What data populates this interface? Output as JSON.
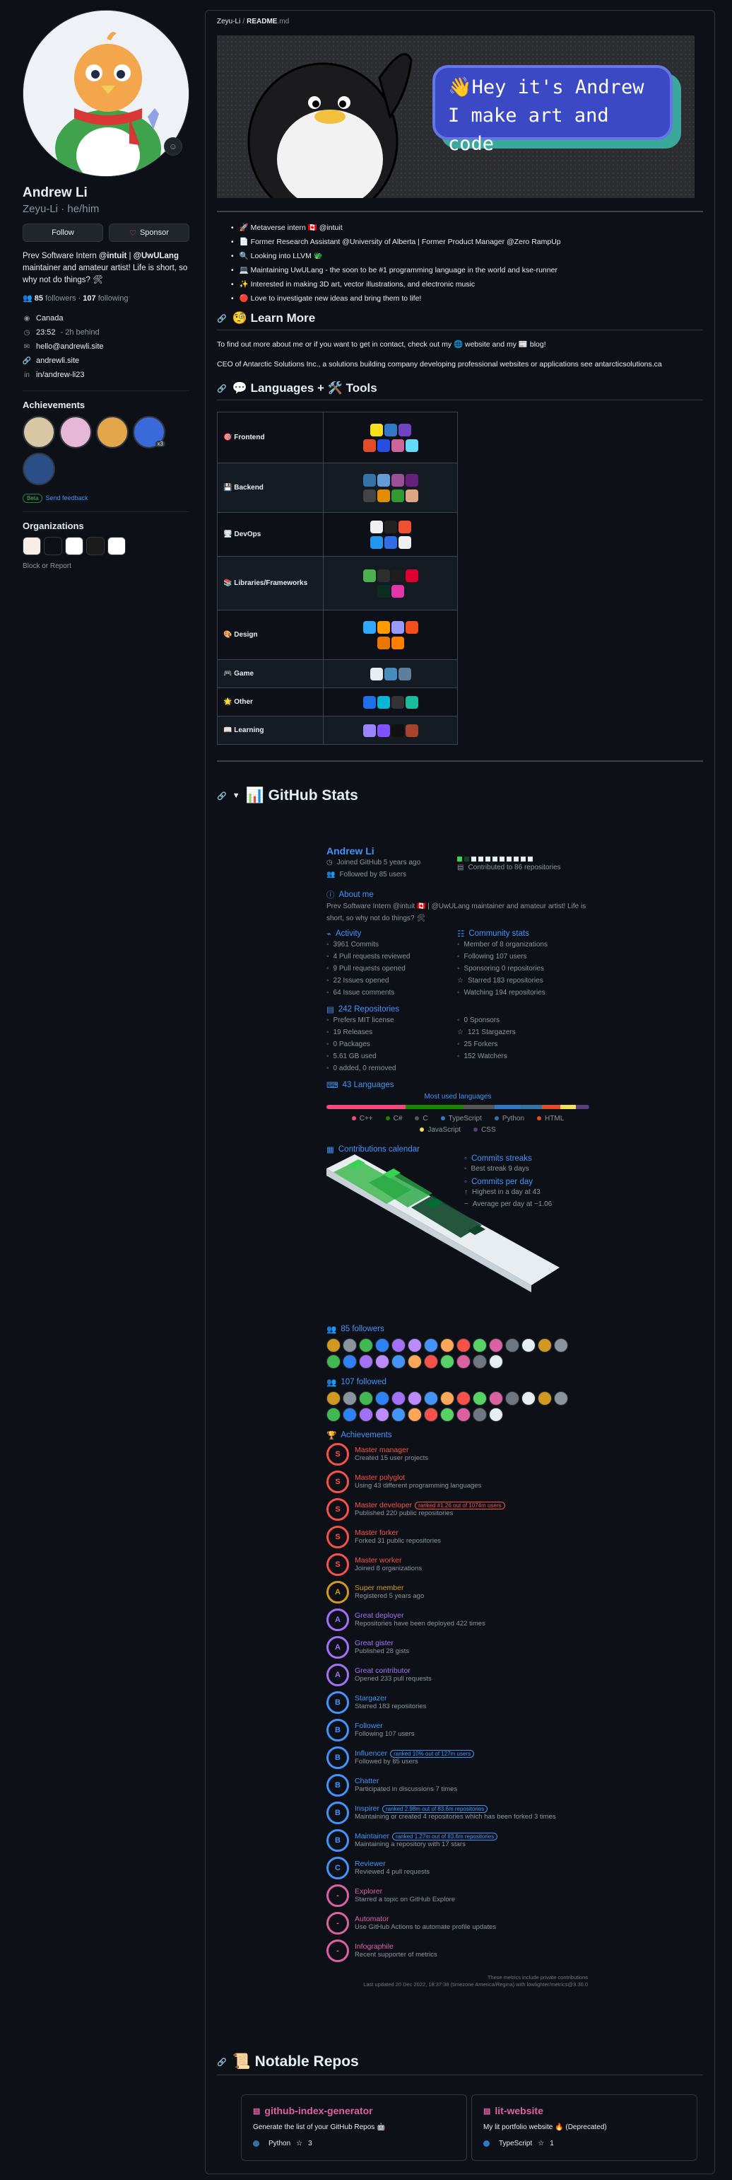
{
  "profile": {
    "name": "Andrew Li",
    "username": "Zeyu-Li",
    "pronouns": "he/him",
    "follow_label": "Follow",
    "sponsor_label": "Sponsor",
    "bio_prefix": "Prev Software Intern ",
    "bio_org1": "@intuit",
    "bio_mid": " | ",
    "bio_org2": "@UwULang",
    "bio_rest": " maintainer and amateur artist! Life is short, so why not do things? 🛠",
    "followers_count": "85",
    "followers_label": "followers",
    "following_count": "107",
    "following_label": "following",
    "location": "Canada",
    "local_time": "23:52",
    "time_note": "- 2h behind",
    "email": "hello@andrewli.site",
    "website": "andrewli.site",
    "linkedin": "in/andrew-li23",
    "achievements_title": "Achievements",
    "achievement_extra": "x3",
    "beta_label": "Beta",
    "send_feedback": "Send feedback",
    "organizations_title": "Organizations",
    "block_report": "Block or Report"
  },
  "readme": {
    "crumb_user": "Zeyu-Li",
    "crumb_file": "README",
    "crumb_ext": ".md",
    "banner_line1": "👋Hey it's Andrew",
    "banner_line2": "I make art and code",
    "facts": [
      "🚀 Metaverse intern 🇨🇦 @intuit",
      "📄 Former Research Assistant @University of Alberta | Former Product Manager @Zero RampUp",
      "🔍 Looking into LLVM 🐲",
      "💻 Maintaining UwULang - the soon to be #1 programming language in the world and kse-runner",
      "✨ Interested in making 3D art, vector illustrations, and electronic music",
      "🔴 Love to investigate new ideas and bring them to life!"
    ],
    "learn_more_title": "🧐 Learn More",
    "learn_more_text": "To find out more about me or if you want to get in contact, check out my 🌐 website and my 📰 blog!",
    "ceo_text": "CEO of Antarctic Solutions Inc., a solutions building company developing professional websites or applications see antarcticsolutions.ca",
    "tools_title": "💬 Languages + 🛠️ Tools",
    "tools": [
      {
        "category": "🎯 Frontend"
      },
      {
        "category": "💾 Backend"
      },
      {
        "category": "🖥 DevOps"
      },
      {
        "category": "📚 Libraries/Frameworks"
      },
      {
        "category": "🎨 Design"
      },
      {
        "category": "🎮 Game"
      },
      {
        "category": "🌟 Other"
      },
      {
        "category": "📖 Learning"
      }
    ],
    "stats_title": "📊 GitHub Stats",
    "repos_title": "📜 Notable Repos"
  },
  "stats": {
    "name": "Andrew Li",
    "joined": "Joined GitHub 5 years ago",
    "followed_by": "Followed by 85 users",
    "contributed": "Contributed to 86 repositories",
    "about_title": "About me",
    "about_text": "Prev Software Intern @intuit 🇨🇦 | @UwULang maintainer and amateur artist! Life is short, so why not do things? 🛠",
    "activity_title": "Activity",
    "activity": [
      "3961 Commits",
      "4 Pull requests reviewed",
      "9 Pull requests opened",
      "22 Issues opened",
      "64 Issue comments"
    ],
    "community_title": "Community stats",
    "community": [
      "Member of 8 organizations",
      "Following 107 users",
      "Sponsoring 0 repositories",
      "Starred 183 repositories",
      "Watching 194 repositories"
    ],
    "repos_title": "242 Repositories",
    "repos_left": [
      "Prefers MIT license",
      "19 Releases",
      "0 Packages",
      "5.61 GB used",
      "0 added, 0 removed"
    ],
    "repos_right": [
      "0 Sponsors",
      "121 Stargazers",
      "25 Forkers",
      "152 Watchers"
    ],
    "languages_title": "43 Languages",
    "most_used": "Most used languages",
    "languages": [
      {
        "name": "C++",
        "color": "#f34b7d"
      },
      {
        "name": "C#",
        "color": "#178600"
      },
      {
        "name": "C",
        "color": "#555555"
      },
      {
        "name": "TypeScript",
        "color": "#3178c6"
      },
      {
        "name": "Python",
        "color": "#3572a5"
      },
      {
        "name": "HTML",
        "color": "#e34c26"
      },
      {
        "name": "JavaScript",
        "color": "#f1e05a"
      },
      {
        "name": "CSS",
        "color": "#563d7c"
      }
    ],
    "calendar_title": "Contributions calendar",
    "streaks_title": "Commits streaks",
    "best_streak": "Best streak 9 days",
    "per_day_title": "Commits per day",
    "highest": "Highest in a day at 43",
    "average": "Average per day at ~1.06",
    "followers_title": "85 followers",
    "following_title": "107 followed",
    "achievements_title": "Achievements",
    "achievements": [
      {
        "name": "Master manager",
        "desc": "Created 15 user projects",
        "rank": "",
        "color": "#f85149",
        "letter": "S"
      },
      {
        "name": "Master polyglot",
        "desc": "Using 43 different programming languages",
        "rank": "",
        "color": "#f85149",
        "letter": "S"
      },
      {
        "name": "Master developer",
        "desc": "Published 220 public repositories",
        "rank": "ranked #1.26 out of 1074m users",
        "color": "#f85149",
        "letter": "S"
      },
      {
        "name": "Master forker",
        "desc": "Forked 31 public repositories",
        "rank": "",
        "color": "#f85149",
        "letter": "S"
      },
      {
        "name": "Master worker",
        "desc": "Joined 8 organizations",
        "rank": "",
        "color": "#f85149",
        "letter": "S"
      },
      {
        "name": "Super member",
        "desc": "Registered 5 years ago",
        "rank": "",
        "color": "#d29922",
        "letter": "A"
      },
      {
        "name": "Great deployer",
        "desc": "Repositories have been deployed 422 times",
        "rank": "",
        "color": "#a371f7",
        "letter": "A"
      },
      {
        "name": "Great gister",
        "desc": "Published 28 gists",
        "rank": "",
        "color": "#a371f7",
        "letter": "A"
      },
      {
        "name": "Great contributor",
        "desc": "Opened 233 pull requests",
        "rank": "",
        "color": "#a371f7",
        "letter": "A"
      },
      {
        "name": "Stargazer",
        "desc": "Starred 183 repositories",
        "rank": "",
        "color": "#4493f8",
        "letter": "B"
      },
      {
        "name": "Follower",
        "desc": "Following 107 users",
        "rank": "",
        "color": "#4493f8",
        "letter": "B"
      },
      {
        "name": "Influencer",
        "desc": "Followed by 85 users",
        "rank": "ranked 10% out of 127m users",
        "color": "#4493f8",
        "letter": "B"
      },
      {
        "name": "Chatter",
        "desc": "Participated in discussions 7 times",
        "rank": "",
        "color": "#4493f8",
        "letter": "B"
      },
      {
        "name": "Inspirer",
        "desc": "Maintaining or created 4 repositories which has been forked 3 times",
        "rank": "ranked 2.98m out of 83.6m repositories",
        "color": "#4493f8",
        "letter": "B"
      },
      {
        "name": "Maintainer",
        "desc": "Maintaining a repository with 17 stars",
        "rank": "ranked 1.27m out of 83.6m repositories",
        "color": "#4493f8",
        "letter": "B"
      },
      {
        "name": "Reviewer",
        "desc": "Reviewed 4 pull requests",
        "rank": "",
        "color": "#4493f8",
        "letter": "C"
      },
      {
        "name": "Explorer",
        "desc": "Starred a topic on GitHub Explore",
        "rank": "",
        "color": "#db61a2",
        "letter": "-"
      },
      {
        "name": "Automator",
        "desc": "Use GitHub Actions to automate profile updates",
        "rank": "",
        "color": "#db61a2",
        "letter": "-"
      },
      {
        "name": "Infographile",
        "desc": "Recent supporter of metrics",
        "rank": "",
        "color": "#db61a2",
        "letter": "-"
      }
    ],
    "footer1": "These metrics include private contributions",
    "footer2": "Last updated 20 Dec 2022, 18:37:38 (timezone America/Regina) with lowlighter/metrics@3.30.0"
  },
  "repos": [
    {
      "name": "github-index-generator",
      "desc": "Generate the list of your GitHub Repos 🤖",
      "lang": "Python",
      "lang_color": "#3572a5",
      "stars": "3"
    },
    {
      "name": "lit-website",
      "desc": "My lit portfolio website 🔥 (Deprecated)",
      "lang": "TypeScript",
      "lang_color": "#3178c6",
      "stars": "1"
    }
  ],
  "colors": {
    "accent": "#4493f8",
    "pink": "#db61a2",
    "bg": "#0d1117",
    "border": "#30363d"
  }
}
